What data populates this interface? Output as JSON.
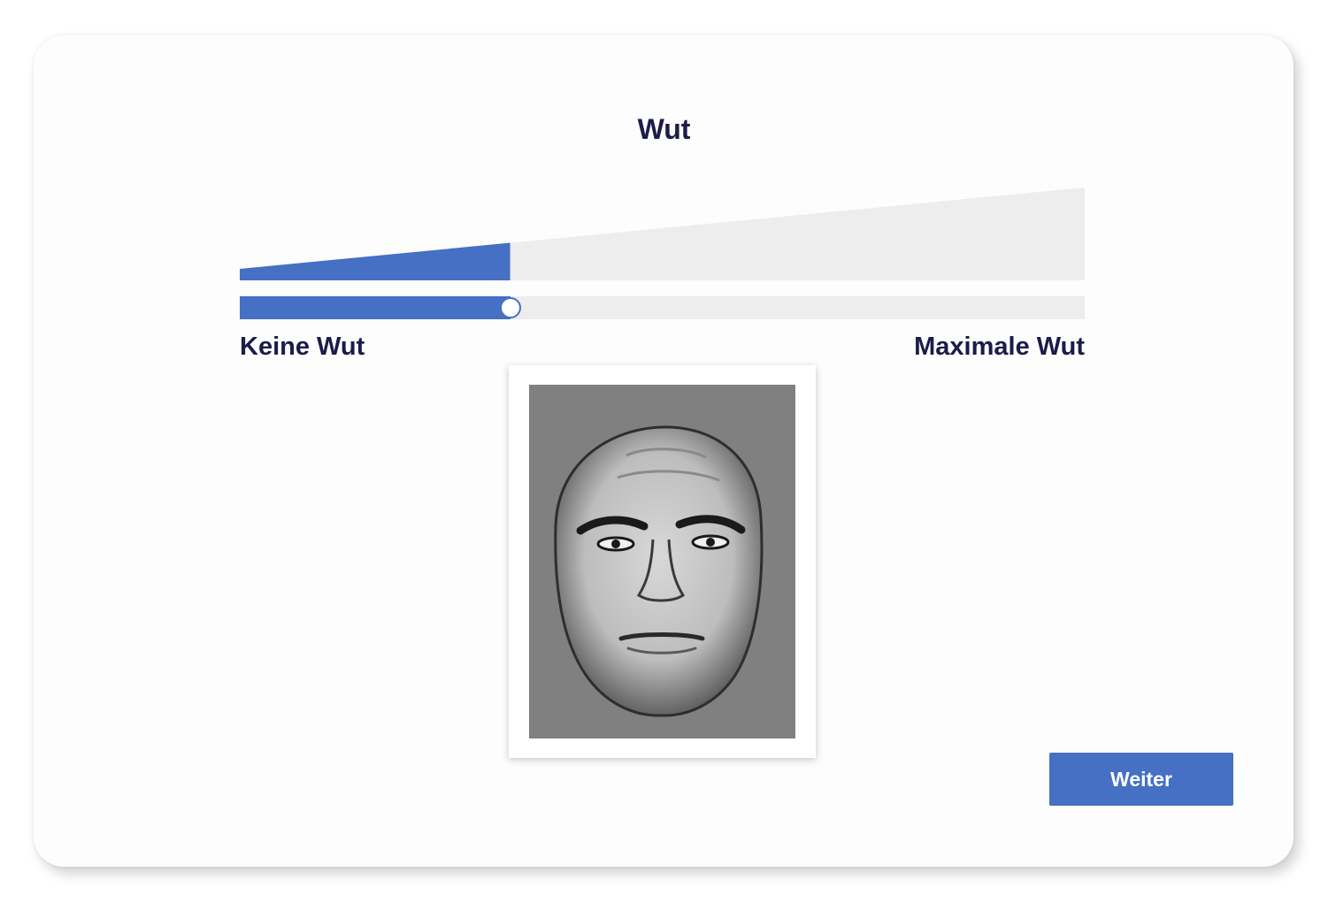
{
  "question": {
    "title": "Wut"
  },
  "scale": {
    "min_label": "Keine Wut",
    "max_label": "Maximale Wut",
    "value_fraction": 0.32,
    "accent_color": "#4570c4",
    "track_color": "#ededed",
    "text_color": "#1c1b4a"
  },
  "stimulus": {
    "icon": "face-photo",
    "background_color": "#808080"
  },
  "actions": {
    "next_label": "Weiter"
  }
}
